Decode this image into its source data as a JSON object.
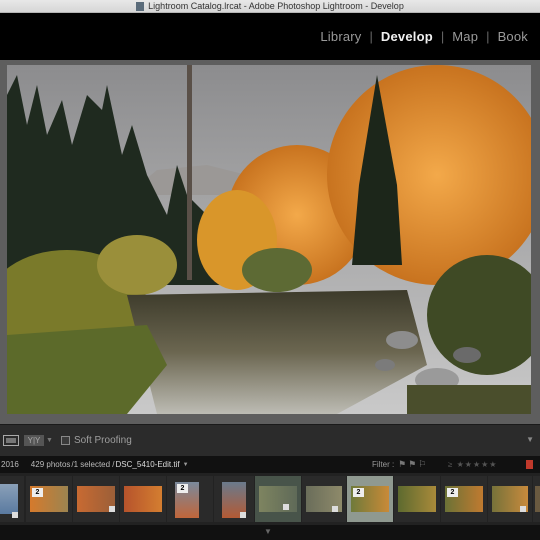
{
  "window": {
    "title": "Lightroom Catalog.lrcat - Adobe Photoshop Lightroom - Develop"
  },
  "modules": [
    {
      "label": "Library",
      "active": false
    },
    {
      "label": "Develop",
      "active": true
    },
    {
      "label": "Map",
      "active": false
    },
    {
      "label": "Book",
      "active": false
    }
  ],
  "toolbar": {
    "compare_label": "Y|Y",
    "soft_proofing_label": "Soft Proofing",
    "soft_proofing_checked": false
  },
  "filmstrip_header": {
    "year": "2016",
    "photo_count": "429 photos",
    "selected": "/1 selected /",
    "filename": "DSC_5410-Edit.tif",
    "filter_label": "Filter :"
  },
  "filmstrip": {
    "badges": [
      "2",
      "2",
      "2",
      "2"
    ]
  },
  "colors": {
    "accent_red": "#c0392b",
    "module_active": "#f0f0f0",
    "module_inactive": "#9a9a9a"
  }
}
